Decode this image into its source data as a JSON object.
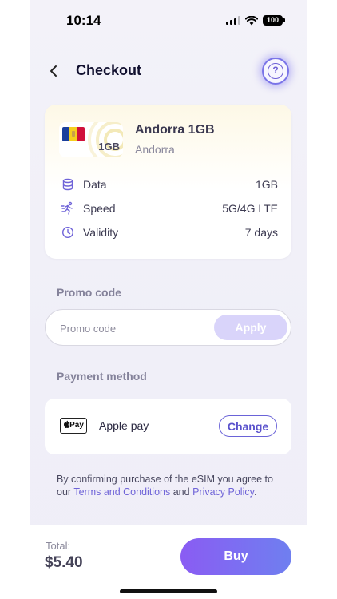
{
  "status_bar": {
    "time": "10:14",
    "battery": "100"
  },
  "header": {
    "title": "Checkout",
    "help_icon": "question-icon"
  },
  "plan": {
    "name": "Andorra 1GB",
    "country": "Andorra",
    "thumb_label": "1GB",
    "details": [
      {
        "icon": "database-icon",
        "label": "Data",
        "value": "1GB"
      },
      {
        "icon": "speed-icon",
        "label": "Speed",
        "value": "5G/4G LTE"
      },
      {
        "icon": "clock-icon",
        "label": "Validity",
        "value": "7 days"
      }
    ]
  },
  "promo": {
    "section_label": "Promo code",
    "placeholder": "Promo code",
    "value": "",
    "apply_label": "Apply"
  },
  "payment": {
    "section_label": "Payment method",
    "badge": "Pay",
    "method": "Apple pay",
    "change_label": "Change"
  },
  "terms": {
    "prefix": "By confirming purchase of the eSIM you agree to our",
    "link1": "Terms and Conditions",
    "joiner": "and",
    "link2": "Privacy Policy",
    "suffix": "."
  },
  "footer": {
    "total_label": "Total:",
    "total_value": "$5.40",
    "buy_label": "Buy"
  },
  "colors": {
    "accent": "#6f63d8",
    "buy_gradient_start": "#8a5cf3",
    "buy_gradient_end": "#6f7ff0",
    "apply_disabled": "#d9d4fa"
  }
}
